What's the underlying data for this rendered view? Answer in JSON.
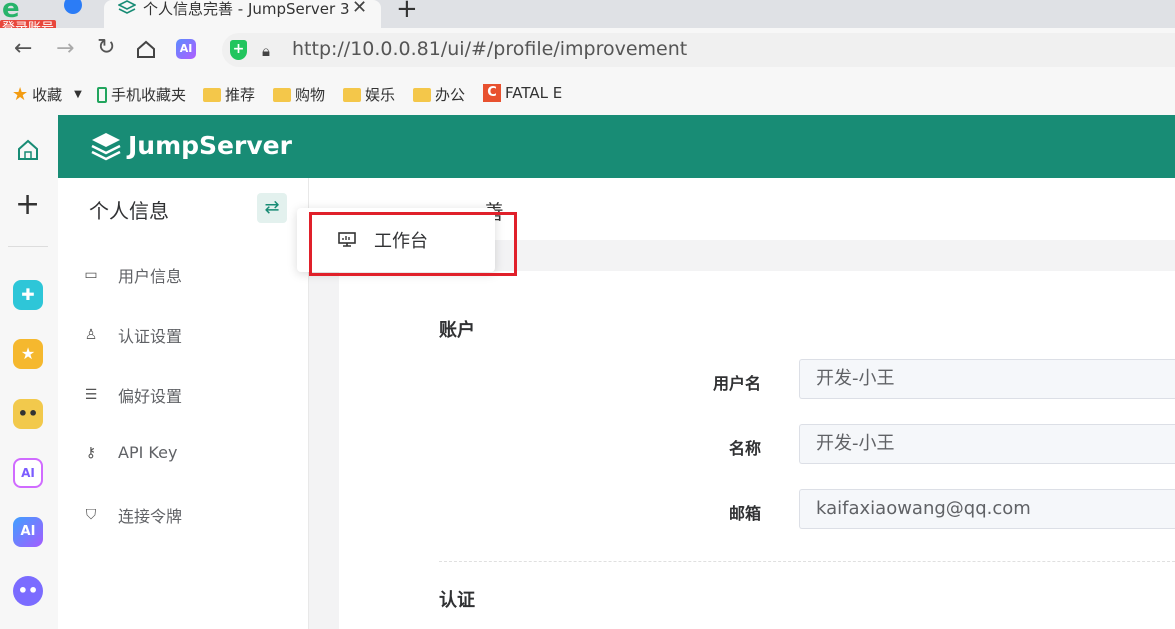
{
  "browser": {
    "tabs": [
      {
        "title": "个人信息完善 - JumpServer 3"
      }
    ],
    "badge_text": "登录账号",
    "url": "http://10.0.0.81/ui/#/profile/improvement",
    "bookmarks": [
      {
        "label": "收藏",
        "icon": "star-icon"
      },
      {
        "label": "手机收藏夹",
        "icon": "phone-icon"
      },
      {
        "label": "推荐",
        "icon": "folder-icon"
      },
      {
        "label": "购物",
        "icon": "folder-icon"
      },
      {
        "label": "娱乐",
        "icon": "folder-icon"
      },
      {
        "label": "办公",
        "icon": "folder-icon"
      },
      {
        "label": "FATAL E",
        "icon": "c-icon"
      }
    ],
    "ai_label": "AI"
  },
  "app": {
    "brand": "JumpServer",
    "accent_color": "#188c75"
  },
  "sidebar": {
    "title": "个人信息",
    "items": [
      {
        "label": "用户信息",
        "icon": "id-card-icon"
      },
      {
        "label": "认证设置",
        "icon": "user-lock-icon"
      },
      {
        "label": "偏好设置",
        "icon": "sliders-icon"
      },
      {
        "label": "API Key",
        "icon": "key-icon"
      },
      {
        "label": "连接令牌",
        "icon": "shield-icon"
      }
    ]
  },
  "dropdown": {
    "items": [
      {
        "label": "工作台",
        "icon": "monitor-icon"
      }
    ]
  },
  "main": {
    "breadcrumb_tail": "善",
    "sections": {
      "account": "账户",
      "auth": "认证"
    },
    "fields": [
      {
        "label": "用户名",
        "value": "开发-小王"
      },
      {
        "label": "名称",
        "value": "开发-小王"
      },
      {
        "label": "邮箱",
        "value": "kaifaxiaowang@qq.com"
      }
    ]
  }
}
